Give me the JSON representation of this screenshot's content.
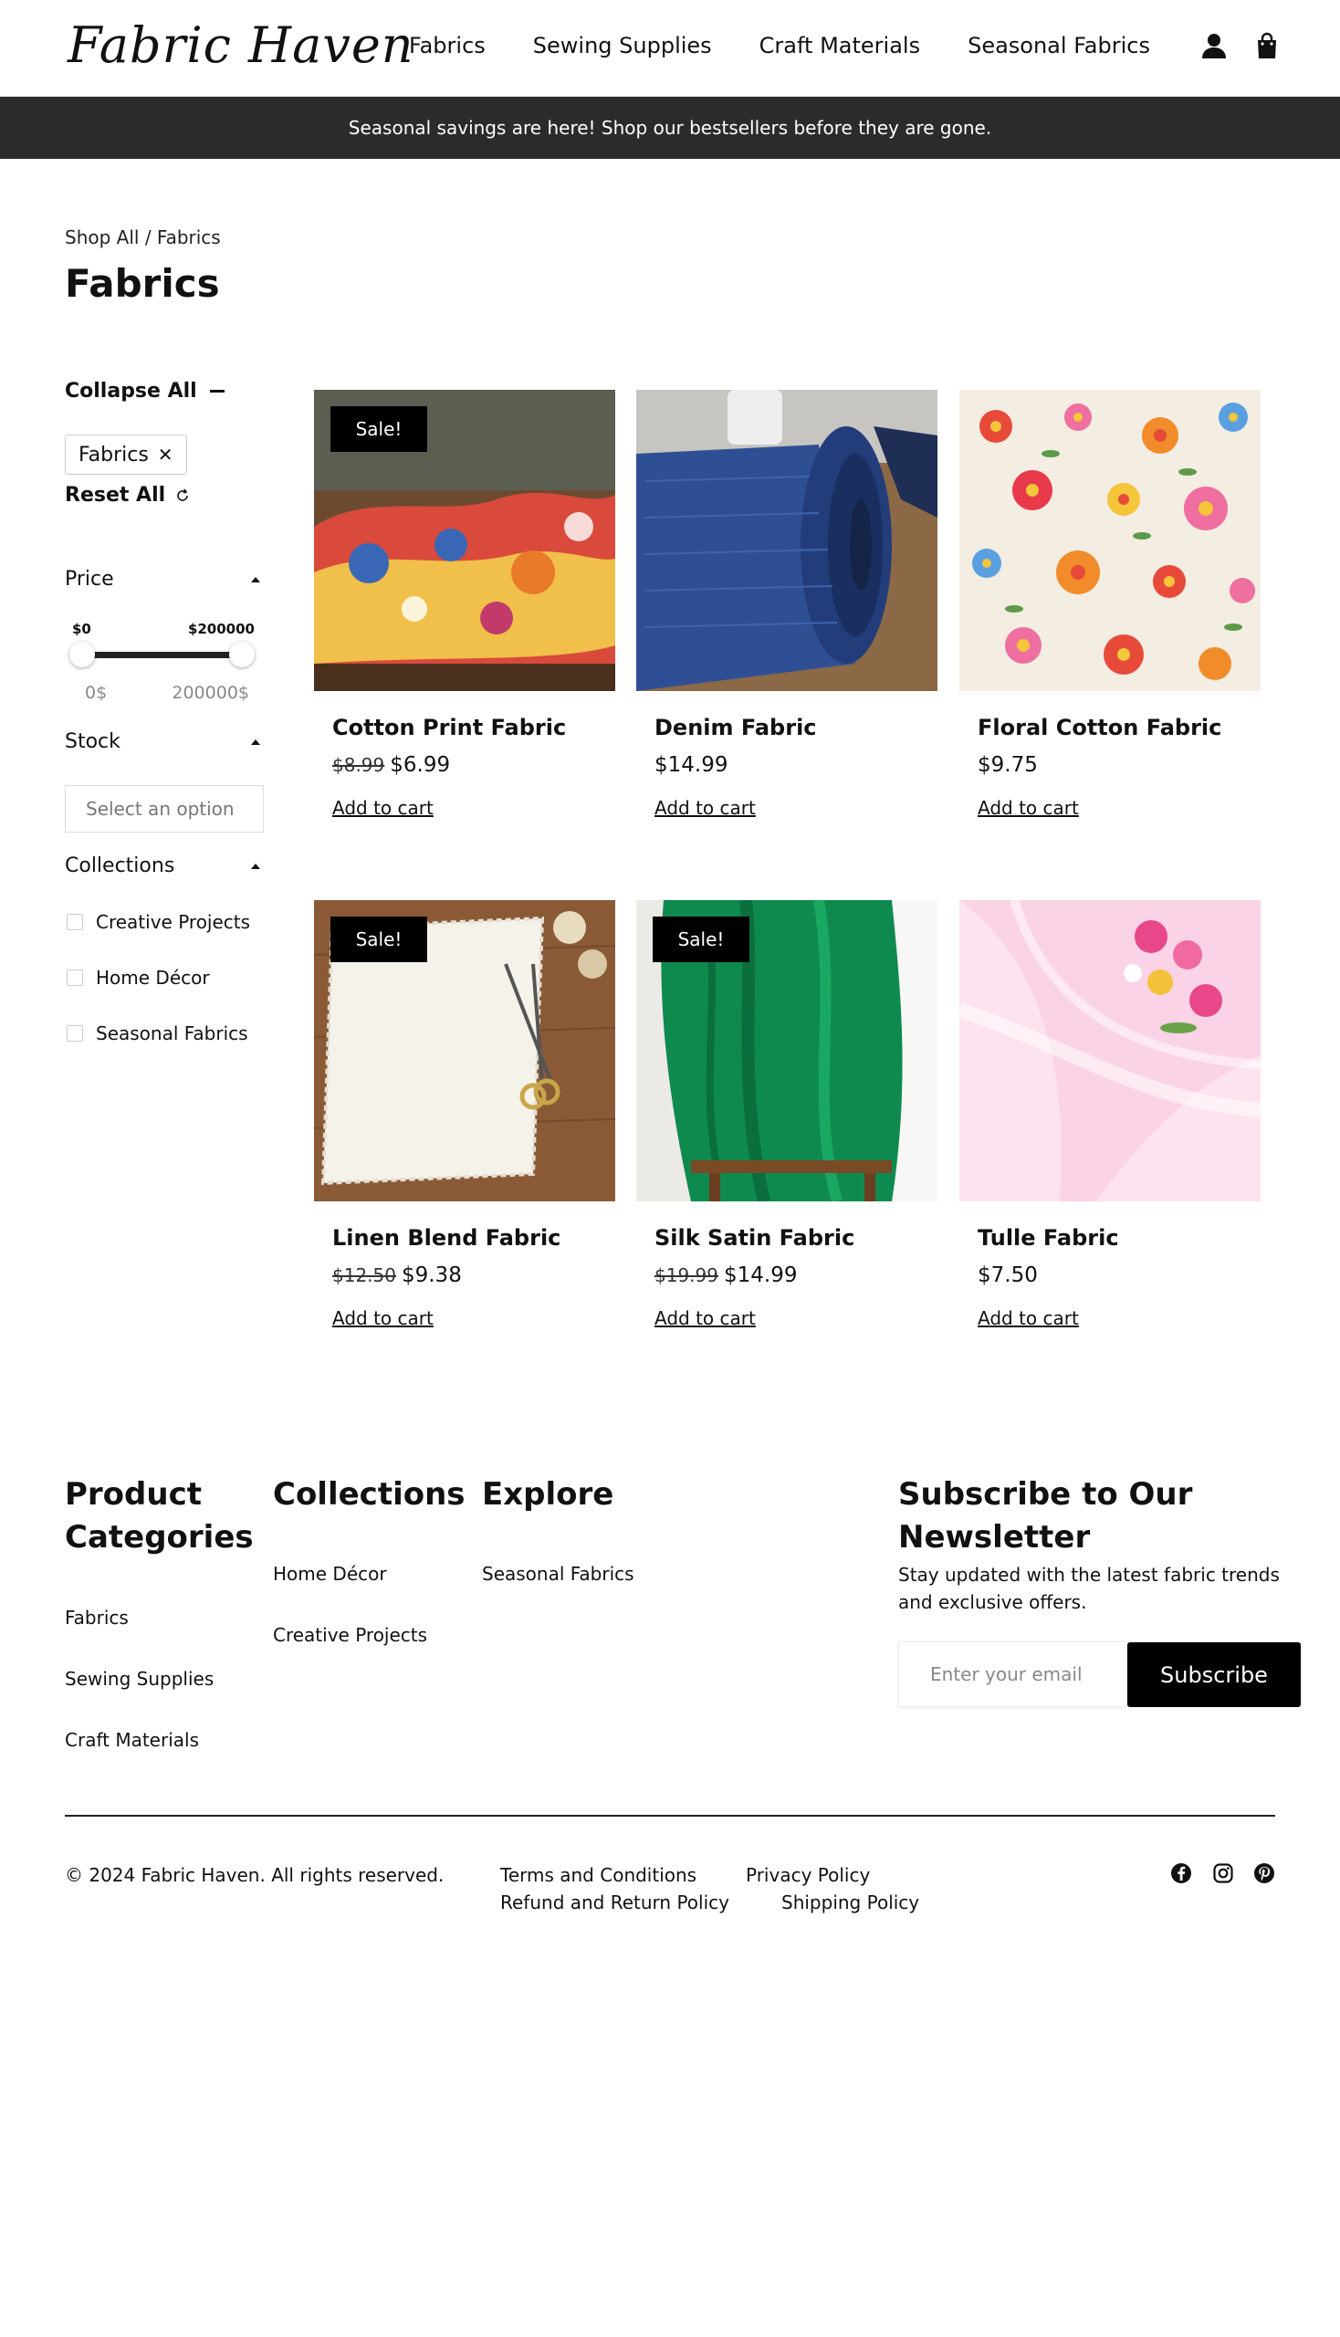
{
  "header": {
    "logo": "Fabric Haven",
    "nav": [
      "Fabrics",
      "Sewing Supplies",
      "Craft Materials",
      "Seasonal Fabrics"
    ],
    "icons": [
      "user-icon",
      "shopping-bag-icon"
    ]
  },
  "banner": "Seasonal savings are here! Shop our bestsellers before they are gone.",
  "breadcrumb": "Shop All / Fabrics",
  "page_title": "Fabrics",
  "sidebar": {
    "collapse_all": "Collapse All",
    "active_filter": "Fabrics",
    "reset_all": "Reset All",
    "price": {
      "label": "Price",
      "min_label": "$0",
      "max_label": "$200000",
      "min_value": "0$",
      "max_value": "200000$"
    },
    "stock": {
      "label": "Stock",
      "placeholder": "Select an option"
    },
    "collections": {
      "label": "Collections",
      "options": [
        "Creative Projects",
        "Home Décor",
        "Seasonal Fabrics"
      ]
    }
  },
  "products": [
    {
      "name": "Cotton Print Fabric",
      "old_price": "$8.99",
      "price": "$6.99",
      "sale": "Sale!",
      "cta": "Add to cart"
    },
    {
      "name": "Denim Fabric",
      "old_price": "",
      "price": "$14.99",
      "sale": "",
      "cta": "Add to cart"
    },
    {
      "name": "Floral Cotton Fabric",
      "old_price": "",
      "price": "$9.75",
      "sale": "",
      "cta": "Add to cart"
    },
    {
      "name": "Linen Blend Fabric",
      "old_price": "$12.50",
      "price": "$9.38",
      "sale": "Sale!",
      "cta": "Add to cart"
    },
    {
      "name": "Silk Satin Fabric",
      "old_price": "$19.99",
      "price": "$14.99",
      "sale": "Sale!",
      "cta": "Add to cart"
    },
    {
      "name": "Tulle Fabric",
      "old_price": "",
      "price": "$7.50",
      "sale": "",
      "cta": "Add to cart"
    }
  ],
  "footer": {
    "product_categories": {
      "title": "Product Categories",
      "links": [
        "Fabrics",
        "Sewing Supplies",
        "Craft Materials"
      ]
    },
    "collections": {
      "title": "Collections",
      "links": [
        "Home Décor",
        "Creative Projects"
      ]
    },
    "explore": {
      "title": "Explore",
      "links": [
        "Seasonal Fabrics"
      ]
    },
    "newsletter": {
      "title": "Subscribe to Our Newsletter",
      "description": "Stay updated with the latest fabric trends and exclusive offers.",
      "placeholder": "Enter your email",
      "button": "Subscribe"
    },
    "copyright": "© 2024 Fabric Haven. All rights reserved.",
    "legal_links": [
      "Terms and Conditions",
      "Privacy Policy",
      "Refund and Return Policy",
      "Shipping Policy"
    ],
    "social_icons": [
      "facebook-icon",
      "instagram-icon",
      "pinterest-icon"
    ]
  },
  "colors": {
    "banner_bg": "#2b2b2b",
    "sale_badge": "#000000",
    "accent": "#000000"
  }
}
